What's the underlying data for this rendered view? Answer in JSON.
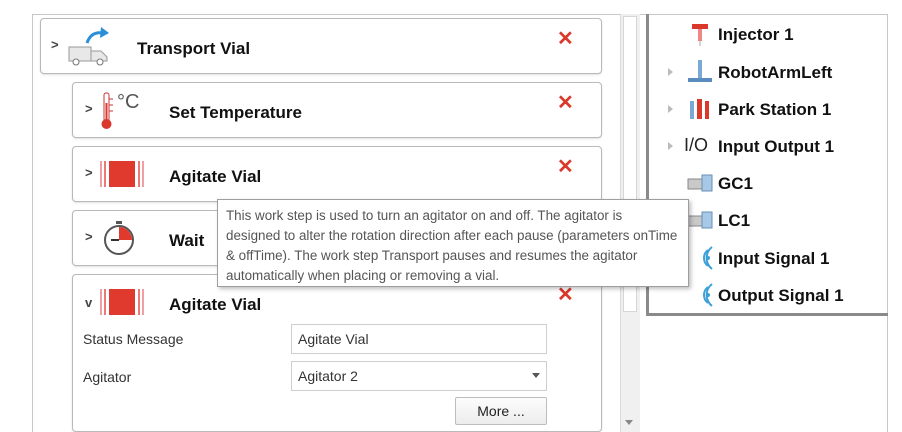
{
  "steps": {
    "transport": {
      "title": "Transport Vial",
      "expanded": false
    },
    "set_temperature": {
      "title": "Set Temperature",
      "expanded": false
    },
    "agitate_1": {
      "title": "Agitate Vial",
      "expanded": false
    },
    "wait": {
      "title": "Wait",
      "expanded": false
    },
    "agitate_2": {
      "title": "Agitate Vial",
      "expanded": true
    }
  },
  "temperature_unit": "°C",
  "detail": {
    "status_label": "Status Message",
    "status_value": "Agitate Vial",
    "agitator_label": "Agitator",
    "agitator_value": "Agitator 2",
    "more_button": "More ..."
  },
  "tooltip": {
    "text": "This work step is used to turn an agitator on and off. The agitator is designed to alter the rotation direction after each pause (parameters onTime & offTime). The work step Transport pauses and resumes the agitator automatically when placing or removing a vial."
  },
  "tree": {
    "items": [
      {
        "label": "Injector 1",
        "icon": "injector-icon",
        "has_children": false
      },
      {
        "label": "RobotArmLeft",
        "icon": "robot-arm-icon",
        "has_children": true
      },
      {
        "label": "Park Station 1",
        "icon": "park-station-icon",
        "has_children": true
      },
      {
        "label": "Input Output 1",
        "icon": "io-icon",
        "prefix": "I/O",
        "has_children": true
      },
      {
        "label": "GC1",
        "icon": "gc-icon",
        "has_children": false
      },
      {
        "label": "LC1",
        "icon": "lc-icon",
        "has_children": false
      },
      {
        "label": "Input Signal 1",
        "icon": "signal-icon",
        "has_children": false
      },
      {
        "label": "Output Signal 1",
        "icon": "signal-icon",
        "has_children": false
      }
    ]
  },
  "colors": {
    "delete": "#d9382a",
    "agitator_red": "#e03a2f",
    "accent_blue": "#2a8fd6"
  }
}
